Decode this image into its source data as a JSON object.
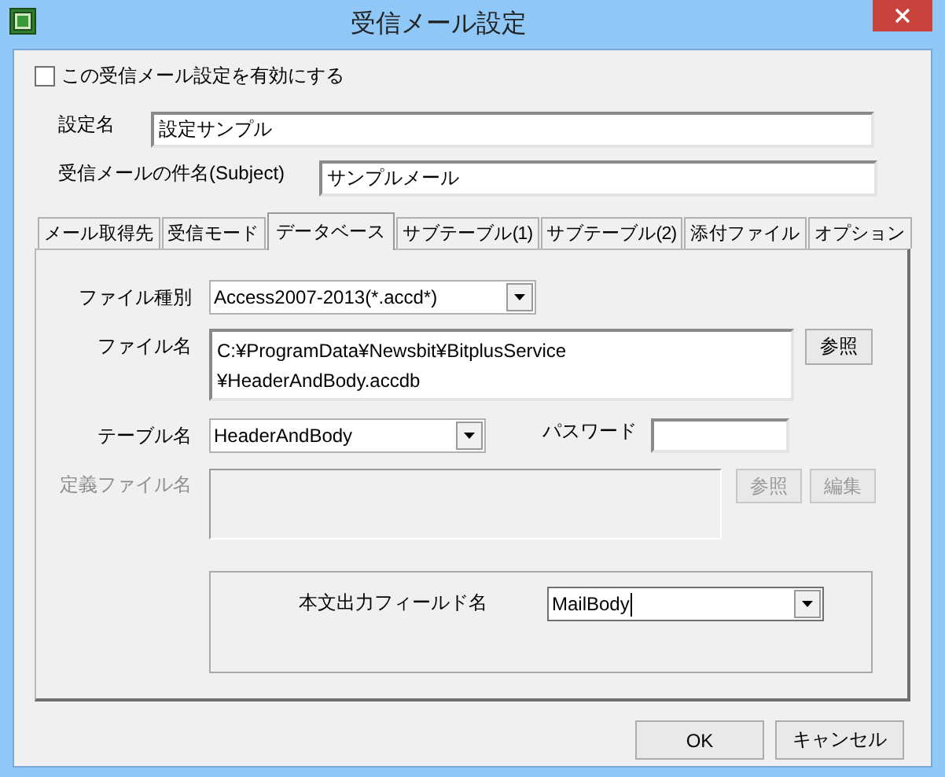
{
  "window": {
    "title": "受信メール設定"
  },
  "enable_checkbox": {
    "label": "この受信メール設定を有効にする",
    "checked": false
  },
  "fields": [
    {
      "label": "設定名",
      "value": "設定サンプル"
    },
    {
      "label": "受信メールの件名(Subject)",
      "value": "サンプルメール"
    }
  ],
  "tabs": [
    {
      "label": "メール取得先",
      "selected": false
    },
    {
      "label": "受信モード",
      "selected": false
    },
    {
      "label": "データベース",
      "selected": true
    },
    {
      "label": "サブテーブル(1)",
      "selected": false
    },
    {
      "label": "サブテーブル(2)",
      "selected": false
    },
    {
      "label": "添付ファイル",
      "selected": false
    },
    {
      "label": "オプション",
      "selected": false
    }
  ],
  "database": {
    "file_type": {
      "label": "ファイル種別",
      "value": "Access2007-2013(*.accd*)"
    },
    "file_name": {
      "label": "ファイル名",
      "lines": [
        "C:¥ProgramData¥Newsbit¥BitplusService",
        "¥HeaderAndBody.accdb"
      ],
      "browse_button": "参照"
    },
    "table_name": {
      "label": "テーブル名",
      "value": "HeaderAndBody"
    },
    "password": {
      "label": "パスワード"
    },
    "definition_file": {
      "label": "定義ファイル名",
      "disabled": true,
      "buttons": [
        {
          "label": "参照",
          "disabled": true
        },
        {
          "label": "編集",
          "disabled": true
        }
      ]
    },
    "body_field": {
      "label": "本文出力フィールド名",
      "value": "MailBody",
      "focused": true
    }
  },
  "buttons": [
    "OK",
    "キャンセル"
  ]
}
